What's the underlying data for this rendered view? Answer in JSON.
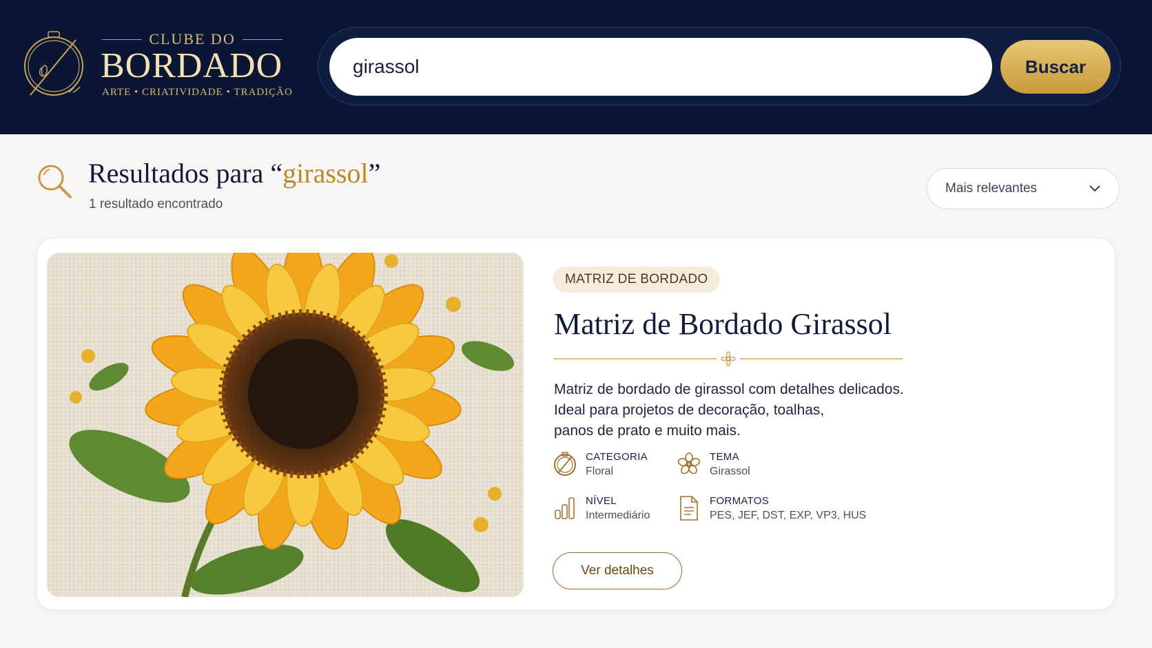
{
  "brand": {
    "top": "CLUBE DO",
    "main": "BORDADO",
    "tagline": "ARTE • CRIATIVIDADE • TRADIÇÃO"
  },
  "search": {
    "value": "girassol",
    "button_label": "Buscar"
  },
  "results": {
    "title_prefix": "Resultados para ",
    "open_quote": "“",
    "query": "girassol",
    "close_quote": "”",
    "count_text": "1 resultado encontrado",
    "sort_selected": "Mais relevantes"
  },
  "card": {
    "badge": "MATRIZ DE BORDADO",
    "title": "Matriz de Bordado Girassol",
    "description_lines": [
      "Matriz de bordado de girassol com detalhes delicados.",
      "Ideal para projetos de decoração, toalhas,",
      "panos de prato e muito mais."
    ],
    "meta": {
      "category": {
        "label": "CATEGORIA",
        "value": "Floral"
      },
      "theme": {
        "label": "TEMA",
        "value": "Girassol"
      },
      "level": {
        "label": "NÍVEL",
        "value": "Intermediário"
      },
      "formats": {
        "label": "FORMATOS",
        "value": "PES, JEF, DST, EXP, VP3, HUS"
      }
    },
    "details_button": "Ver detalhes"
  },
  "colors": {
    "header_bg": "#0b1634",
    "gold": "#c8a45a",
    "accent_text": "#b8892c",
    "page_bg": "#f7f6f4"
  },
  "icons": {
    "logo": "embroidery-hoop-needle-icon",
    "results": "magnifier-icon",
    "sort": "chevron-down-icon",
    "category": "hoop-icon",
    "theme": "flower-icon",
    "level": "bars-icon",
    "formats": "document-icon",
    "divider": "ornament-flower-icon"
  }
}
